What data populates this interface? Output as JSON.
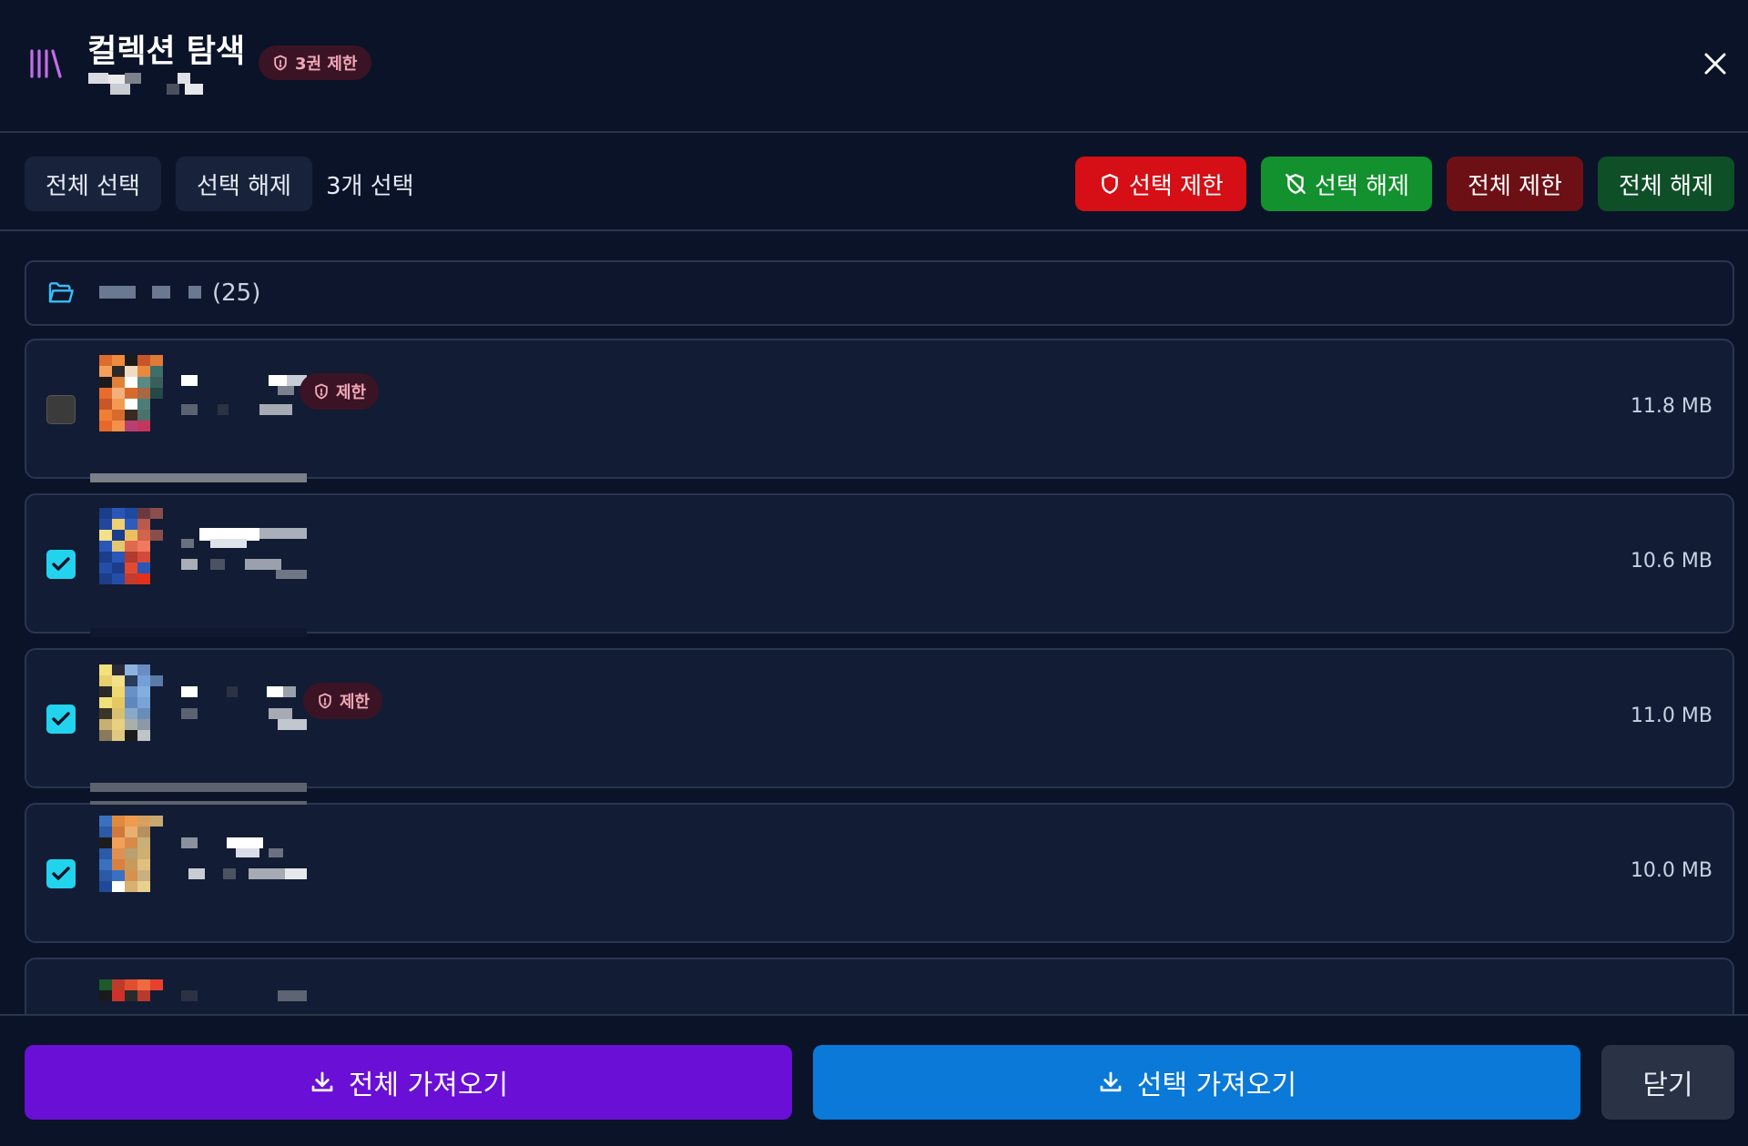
{
  "header": {
    "title": "컬렉션 탐색",
    "badge_label": "3권 제한",
    "icons": {
      "logo": "library-icon",
      "badge": "shield-icon",
      "close": "close-icon"
    }
  },
  "toolbar": {
    "select_all_label": "전체 선택",
    "deselect_label": "선택 해제",
    "selected_count": "3개 선택",
    "restrict_selected_label": "선택 제한",
    "unrestrict_selected_label": "선택 해제",
    "restrict_all_label": "전체 제한",
    "unrestrict_all_label": "전체 해제",
    "colors": {
      "red": "#d50f15",
      "green": "#13912f",
      "darkred": "#6c1016",
      "darkgreen": "#0f4f28"
    }
  },
  "folder": {
    "count": "(25)",
    "icon": "folder-open-icon"
  },
  "items": [
    {
      "checked": false,
      "restricted": true,
      "restricted_label": "제한",
      "size": "11.8 MB"
    },
    {
      "checked": true,
      "restricted": false,
      "restricted_label": "",
      "size": "10.6 MB"
    },
    {
      "checked": true,
      "restricted": true,
      "restricted_label": "제한",
      "size": "11.0 MB"
    },
    {
      "checked": true,
      "restricted": false,
      "restricted_label": "",
      "size": "10.0 MB"
    }
  ],
  "footer": {
    "import_all_label": "전체 가져오기",
    "import_selected_label": "선택 가져오기",
    "close_label": "닫기",
    "colors": {
      "import_all": "#6a0fd6",
      "import_selected": "#0a79d8"
    }
  }
}
